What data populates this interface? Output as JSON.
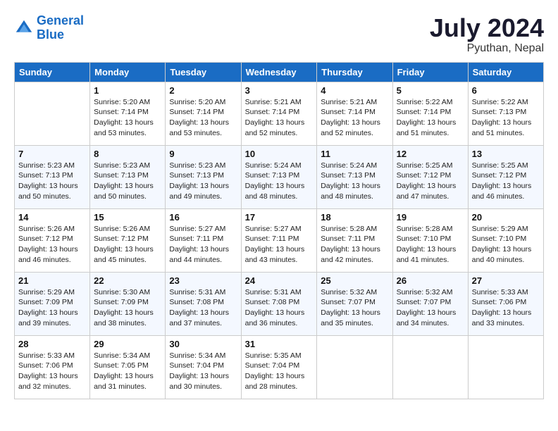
{
  "header": {
    "logo_line1": "General",
    "logo_line2": "Blue",
    "month_year": "July 2024",
    "location": "Pyuthan, Nepal"
  },
  "columns": [
    "Sunday",
    "Monday",
    "Tuesday",
    "Wednesday",
    "Thursday",
    "Friday",
    "Saturday"
  ],
  "weeks": [
    [
      {
        "day": "",
        "sunrise": "",
        "sunset": "",
        "daylight": ""
      },
      {
        "day": "1",
        "sunrise": "Sunrise: 5:20 AM",
        "sunset": "Sunset: 7:14 PM",
        "daylight": "Daylight: 13 hours and 53 minutes."
      },
      {
        "day": "2",
        "sunrise": "Sunrise: 5:20 AM",
        "sunset": "Sunset: 7:14 PM",
        "daylight": "Daylight: 13 hours and 53 minutes."
      },
      {
        "day": "3",
        "sunrise": "Sunrise: 5:21 AM",
        "sunset": "Sunset: 7:14 PM",
        "daylight": "Daylight: 13 hours and 52 minutes."
      },
      {
        "day": "4",
        "sunrise": "Sunrise: 5:21 AM",
        "sunset": "Sunset: 7:14 PM",
        "daylight": "Daylight: 13 hours and 52 minutes."
      },
      {
        "day": "5",
        "sunrise": "Sunrise: 5:22 AM",
        "sunset": "Sunset: 7:14 PM",
        "daylight": "Daylight: 13 hours and 51 minutes."
      },
      {
        "day": "6",
        "sunrise": "Sunrise: 5:22 AM",
        "sunset": "Sunset: 7:13 PM",
        "daylight": "Daylight: 13 hours and 51 minutes."
      }
    ],
    [
      {
        "day": "7",
        "sunrise": "Sunrise: 5:23 AM",
        "sunset": "Sunset: 7:13 PM",
        "daylight": "Daylight: 13 hours and 50 minutes."
      },
      {
        "day": "8",
        "sunrise": "Sunrise: 5:23 AM",
        "sunset": "Sunset: 7:13 PM",
        "daylight": "Daylight: 13 hours and 50 minutes."
      },
      {
        "day": "9",
        "sunrise": "Sunrise: 5:23 AM",
        "sunset": "Sunset: 7:13 PM",
        "daylight": "Daylight: 13 hours and 49 minutes."
      },
      {
        "day": "10",
        "sunrise": "Sunrise: 5:24 AM",
        "sunset": "Sunset: 7:13 PM",
        "daylight": "Daylight: 13 hours and 48 minutes."
      },
      {
        "day": "11",
        "sunrise": "Sunrise: 5:24 AM",
        "sunset": "Sunset: 7:13 PM",
        "daylight": "Daylight: 13 hours and 48 minutes."
      },
      {
        "day": "12",
        "sunrise": "Sunrise: 5:25 AM",
        "sunset": "Sunset: 7:12 PM",
        "daylight": "Daylight: 13 hours and 47 minutes."
      },
      {
        "day": "13",
        "sunrise": "Sunrise: 5:25 AM",
        "sunset": "Sunset: 7:12 PM",
        "daylight": "Daylight: 13 hours and 46 minutes."
      }
    ],
    [
      {
        "day": "14",
        "sunrise": "Sunrise: 5:26 AM",
        "sunset": "Sunset: 7:12 PM",
        "daylight": "Daylight: 13 hours and 46 minutes."
      },
      {
        "day": "15",
        "sunrise": "Sunrise: 5:26 AM",
        "sunset": "Sunset: 7:12 PM",
        "daylight": "Daylight: 13 hours and 45 minutes."
      },
      {
        "day": "16",
        "sunrise": "Sunrise: 5:27 AM",
        "sunset": "Sunset: 7:11 PM",
        "daylight": "Daylight: 13 hours and 44 minutes."
      },
      {
        "day": "17",
        "sunrise": "Sunrise: 5:27 AM",
        "sunset": "Sunset: 7:11 PM",
        "daylight": "Daylight: 13 hours and 43 minutes."
      },
      {
        "day": "18",
        "sunrise": "Sunrise: 5:28 AM",
        "sunset": "Sunset: 7:11 PM",
        "daylight": "Daylight: 13 hours and 42 minutes."
      },
      {
        "day": "19",
        "sunrise": "Sunrise: 5:28 AM",
        "sunset": "Sunset: 7:10 PM",
        "daylight": "Daylight: 13 hours and 41 minutes."
      },
      {
        "day": "20",
        "sunrise": "Sunrise: 5:29 AM",
        "sunset": "Sunset: 7:10 PM",
        "daylight": "Daylight: 13 hours and 40 minutes."
      }
    ],
    [
      {
        "day": "21",
        "sunrise": "Sunrise: 5:29 AM",
        "sunset": "Sunset: 7:09 PM",
        "daylight": "Daylight: 13 hours and 39 minutes."
      },
      {
        "day": "22",
        "sunrise": "Sunrise: 5:30 AM",
        "sunset": "Sunset: 7:09 PM",
        "daylight": "Daylight: 13 hours and 38 minutes."
      },
      {
        "day": "23",
        "sunrise": "Sunrise: 5:31 AM",
        "sunset": "Sunset: 7:08 PM",
        "daylight": "Daylight: 13 hours and 37 minutes."
      },
      {
        "day": "24",
        "sunrise": "Sunrise: 5:31 AM",
        "sunset": "Sunset: 7:08 PM",
        "daylight": "Daylight: 13 hours and 36 minutes."
      },
      {
        "day": "25",
        "sunrise": "Sunrise: 5:32 AM",
        "sunset": "Sunset: 7:07 PM",
        "daylight": "Daylight: 13 hours and 35 minutes."
      },
      {
        "day": "26",
        "sunrise": "Sunrise: 5:32 AM",
        "sunset": "Sunset: 7:07 PM",
        "daylight": "Daylight: 13 hours and 34 minutes."
      },
      {
        "day": "27",
        "sunrise": "Sunrise: 5:33 AM",
        "sunset": "Sunset: 7:06 PM",
        "daylight": "Daylight: 13 hours and 33 minutes."
      }
    ],
    [
      {
        "day": "28",
        "sunrise": "Sunrise: 5:33 AM",
        "sunset": "Sunset: 7:06 PM",
        "daylight": "Daylight: 13 hours and 32 minutes."
      },
      {
        "day": "29",
        "sunrise": "Sunrise: 5:34 AM",
        "sunset": "Sunset: 7:05 PM",
        "daylight": "Daylight: 13 hours and 31 minutes."
      },
      {
        "day": "30",
        "sunrise": "Sunrise: 5:34 AM",
        "sunset": "Sunset: 7:04 PM",
        "daylight": "Daylight: 13 hours and 30 minutes."
      },
      {
        "day": "31",
        "sunrise": "Sunrise: 5:35 AM",
        "sunset": "Sunset: 7:04 PM",
        "daylight": "Daylight: 13 hours and 28 minutes."
      },
      {
        "day": "",
        "sunrise": "",
        "sunset": "",
        "daylight": ""
      },
      {
        "day": "",
        "sunrise": "",
        "sunset": "",
        "daylight": ""
      },
      {
        "day": "",
        "sunrise": "",
        "sunset": "",
        "daylight": ""
      }
    ]
  ]
}
